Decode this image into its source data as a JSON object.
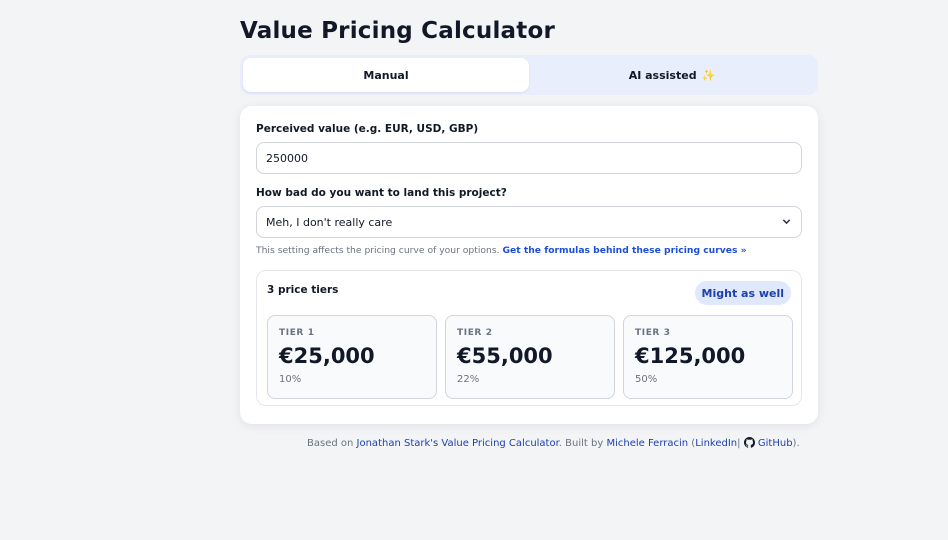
{
  "page": {
    "title": "Value Pricing Calculator"
  },
  "tabs": [
    {
      "label": "Manual",
      "active": true
    },
    {
      "label": "AI assisted",
      "icon": "sparkles-icon",
      "active": false
    }
  ],
  "form": {
    "perceived_value_label": "Perceived value (e.g. EUR, USD, GBP)",
    "perceived_value": "250000",
    "urgency_label": "How bad do you want to land this project?",
    "urgency_selected": "Meh, I don't really care",
    "hint_text": "This setting affects the pricing curve of your options.",
    "hint_link": "Get the formulas behind these pricing curves »"
  },
  "tiers": {
    "title": "3 price tiers",
    "badge": "Might as well",
    "items": [
      {
        "label": "TIER 1",
        "price": "€25,000",
        "percent": "10%"
      },
      {
        "label": "TIER 2",
        "price": "€55,000",
        "percent": "22%"
      },
      {
        "label": "TIER 3",
        "price": "€125,000",
        "percent": "50%"
      }
    ]
  },
  "footer": {
    "based_on": "Based on",
    "source_link": "Jonathan Stark's Value Pricing Calculator",
    "built_by": ". Built by",
    "author_link": "Michele Ferracin",
    "open_paren": " (",
    "linkedin": "LinkedIn",
    "separator": "|",
    "github": "GitHub",
    "close": ")."
  },
  "colors": {
    "accent": "#1e40af",
    "tab_bg": "#e8eefb",
    "badge_bg": "#e0e9fb"
  }
}
